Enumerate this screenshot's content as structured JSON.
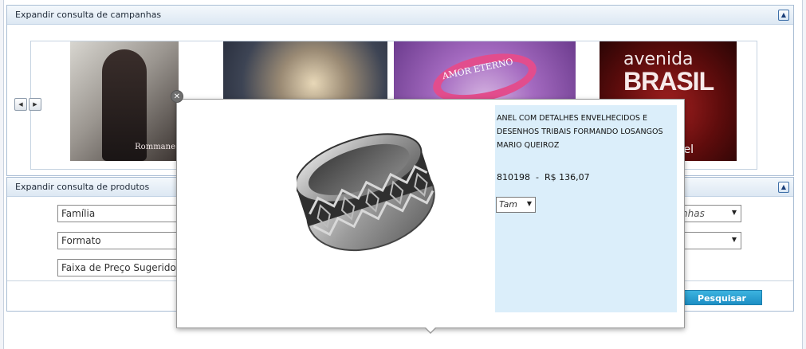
{
  "campaigns_panel": {
    "title": "Expandir consulta de campanhas",
    "collapse_icon": "chevron-up-icon",
    "banners": [
      {
        "name": "rommanel-model",
        "brand_text": "Rommane"
      },
      {
        "name": "blonde-model"
      },
      {
        "name": "amor-eterno",
        "text": "AMOR ETERNO"
      },
      {
        "name": "avenida-brasil",
        "line1": "avenida",
        "line2": "BRASIL",
        "line3": "anel"
      }
    ],
    "nav": {
      "prev_icon": "triangle-left-icon",
      "next_icon": "triangle-right-icon"
    }
  },
  "products_panel": {
    "title": "Expandir consulta de produtos",
    "collapse_icon": "chevron-up-icon",
    "filters_left": [
      {
        "name": "familia",
        "value": "Família"
      },
      {
        "name": "formato",
        "value": "Formato"
      },
      {
        "name": "faixa-preco",
        "value": "Faixa de Preço Sugerido"
      }
    ],
    "filter_right_1": "nhas",
    "filter_right_2": "",
    "search_label": "Pesquisar"
  },
  "popup": {
    "product_name": "ANEL COM DETALHES ENVELHECIDOS E DESENHOS TRIBAIS FORMANDO LOSANGOS MARIO QUEIROZ",
    "product_code": "810198",
    "separator": "-",
    "price": "R$ 136,07",
    "size_placeholder": "Tam",
    "close_icon": "close-icon",
    "image_icon": "ring-icon"
  },
  "colors": {
    "accent": "#1d8fc4",
    "panel_border": "#a9bdd4",
    "info_bg": "#dbeefa"
  }
}
